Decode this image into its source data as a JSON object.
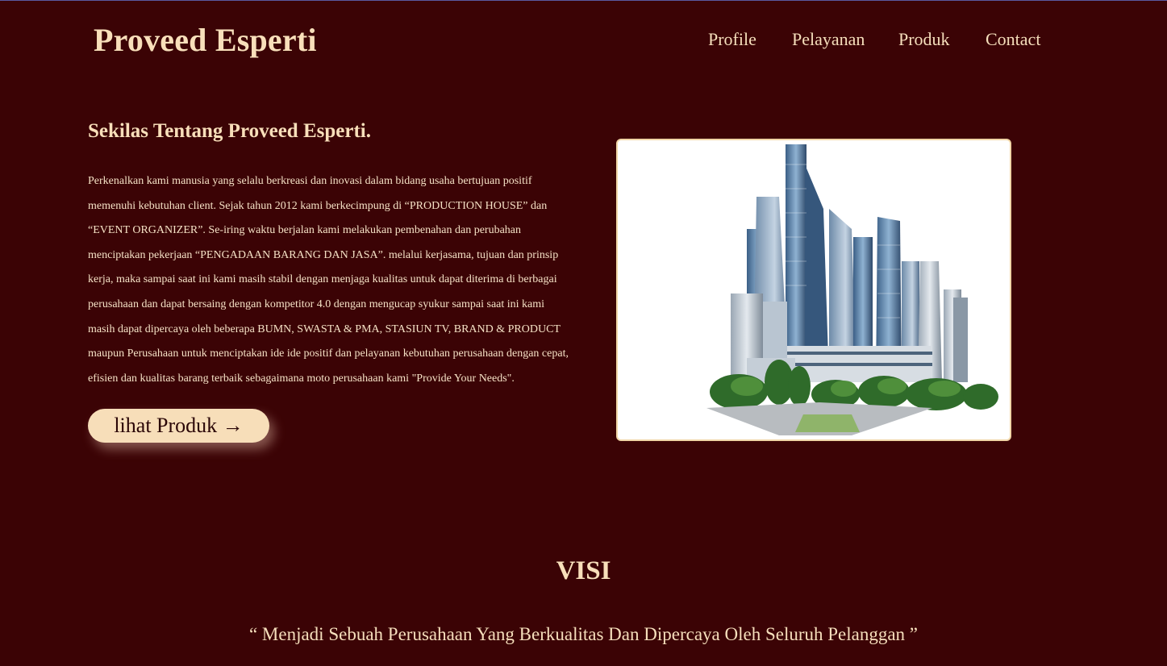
{
  "header": {
    "brand": "Proveed Esperti",
    "nav": [
      "Profile",
      "Pelayanan",
      "Produk",
      "Contact"
    ]
  },
  "about": {
    "title": "Sekilas Tentang Proveed Esperti.",
    "lines": [
      "Perkenalkan kami manusia yang selalu berkreasi dan inovasi dalam bidang usaha bertujuan positif",
      "memenuhi kebutuhan client. Sejak tahun 2012 kami berkecimpung di “PRODUCTION HOUSE” dan",
      "“EVENT ORGANIZER”. Se-iring waktu berjalan kami melakukan pembenahan dan perubahan",
      "menciptakan pekerjaan “PENGADAAN BARANG DAN JASA”. melalui kerjasama, tujuan dan prinsip",
      "kerja, maka sampai saat ini kami masih stabil dengan menjaga kualitas untuk dapat diterima di berbagai",
      "perusahaan dan dapat bersaing dengan kompetitor 4.0 dengan mengucap syukur sampai saat ini kami",
      "masih dapat dipercaya oleh beberapa BUMN, SWASTA & PMA, STASIUN TV, BRAND & PRODUCT",
      "maupun Perusahaan untuk menciptakan ide ide positif dan pelayanan kebutuhan perusahaan dengan cepat,",
      "efisien dan kualitas barang terbaik sebagaimana moto perusahaan kami \"Provide Your Needs\"."
    ],
    "button_label": "lihat Produk →",
    "image_alt": "city-buildings-illustration"
  },
  "visi": {
    "title": "VISI",
    "text": "“ Menjadi Sebuah Perusahaan Yang Berkualitas Dan Dipercaya Oleh Seluruh Pelanggan ”"
  },
  "colors": {
    "background": "#3b0305",
    "text": "#f6dfbc",
    "button_bg": "#f7deb9",
    "button_text": "#2a0607"
  }
}
